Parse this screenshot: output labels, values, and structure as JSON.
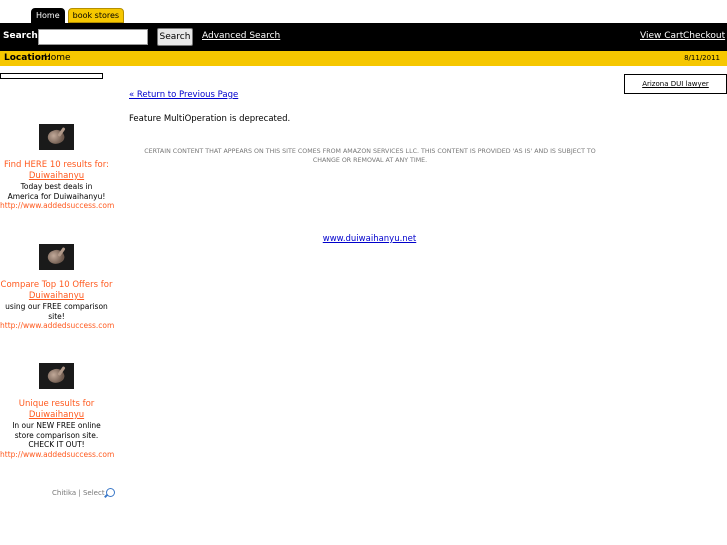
{
  "tabs": [
    {
      "label": "Home"
    },
    {
      "label": "book stores"
    }
  ],
  "search": {
    "label": "Search",
    "value": "",
    "button_label": "Search",
    "advanced_label": "Advanced Search"
  },
  "cart": {
    "view_cart_label": "View Cart",
    "checkout_label": "Checkout"
  },
  "location": {
    "label": "Location:",
    "value": "Home",
    "date": "8/11/2011"
  },
  "main": {
    "return_label": "« Return to Previous Page",
    "deprecated_message": "Feature MultiOperation is deprecated.",
    "disclaimer": "CERTAIN CONTENT THAT APPEARS ON THIS SITE COMES FROM AMAZON SERVICES LLC. THIS CONTENT IS PROVIDED 'AS IS' AND IS SUBJECT TO CHANGE OR REMOVAL AT ANY TIME.",
    "domain_link": "www.duiwaihanyu.net"
  },
  "ads": [
    {
      "headline": "Find HERE 10 results for:",
      "keyword": "Duiwaihanyu",
      "description": "Today best deals in America for Duiwaihanyu!",
      "url": "http://www.addedsuccess.com"
    },
    {
      "headline": "Compare Top 10 Offers for",
      "keyword": "Duiwaihanyu",
      "description": "using our FREE comparison site!",
      "url": "http://www.addedsuccess.com"
    },
    {
      "headline": "Unique results for",
      "keyword": "Duiwaihanyu",
      "description": "In our NEW FREE online store comparison site. CHECK IT OUT!",
      "url": "http://www.addedsuccess.com"
    }
  ],
  "chitika": {
    "label": "Chitika | Select"
  },
  "right_ad": {
    "label": "Arizona DUI lawyer"
  },
  "colors": {
    "accent_yellow": "#f6c700",
    "bar_black": "#000000",
    "ad_orange": "#ff5a1f",
    "link_blue": "#0000cc"
  },
  "icons": [
    "magnifier-icon",
    "ad-thumbnail"
  ]
}
